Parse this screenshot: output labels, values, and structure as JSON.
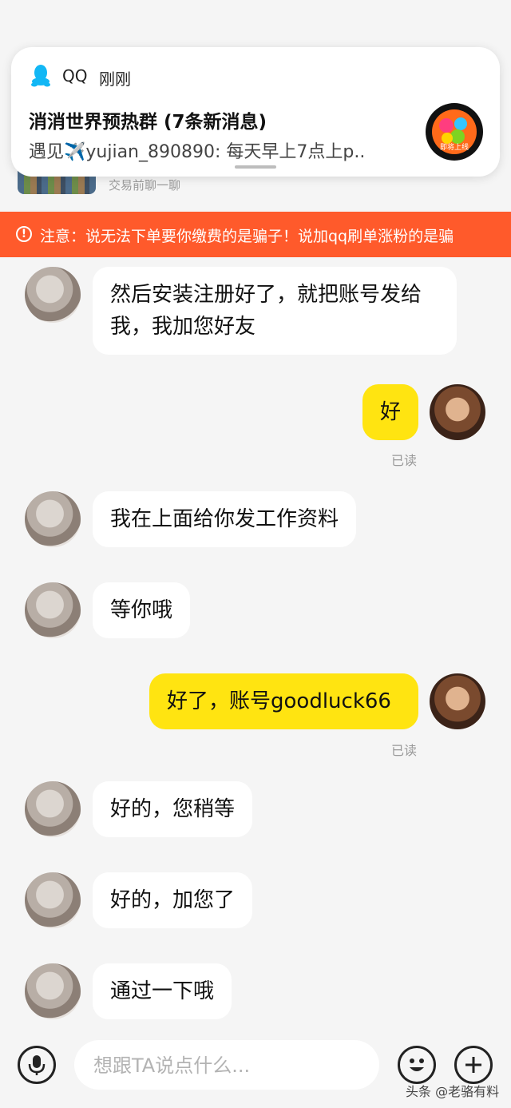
{
  "product": {
    "subtitle": "交易前聊一聊"
  },
  "notification": {
    "app_name": "QQ",
    "time": "刚刚",
    "title": "消消世界预热群 (7条新消息)",
    "body": "遇见✈️yujian_890890: 每天早上7点上p..",
    "avatar_badge": "即将上线"
  },
  "warning": {
    "icon": "!",
    "text": "注意：说无法下单要你缴费的是骗子！说加qq刷单涨粉的是骗"
  },
  "messages": [
    {
      "side": "in",
      "text": "然后安装注册好了，就把账号发给我，我加您好友"
    },
    {
      "side": "out",
      "text": "好",
      "status": "已读"
    },
    {
      "side": "in",
      "text": "我在上面给你发工作资料"
    },
    {
      "side": "in",
      "text": "等你哦"
    },
    {
      "side": "out",
      "text": "好了，账号goodluck66",
      "status": "已读"
    },
    {
      "side": "in",
      "text": "好的，您稍等"
    },
    {
      "side": "in",
      "text": "好的，加您了"
    },
    {
      "side": "in",
      "text": "通过一下哦"
    }
  ],
  "input": {
    "placeholder": "想跟TA说点什么..."
  },
  "watermark": "头条 @老骆有料",
  "colors": {
    "warning_bg": "#ff5a2b",
    "outgoing_bubble": "#ffe411",
    "incoming_bubble": "#ffffff"
  }
}
